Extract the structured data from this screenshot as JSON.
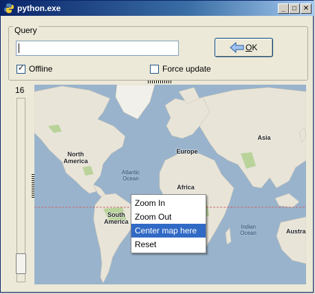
{
  "window": {
    "title": "python.exe",
    "buttons": {
      "minimize": "_",
      "maximize": "□",
      "close": "✕"
    }
  },
  "query": {
    "group_label": "Query",
    "input_value": "",
    "ok_label": "OK"
  },
  "options": {
    "offline_label": "Offline",
    "offline_checked": true,
    "force_update_label": "Force update",
    "force_update_checked": false
  },
  "zoom": {
    "level": "16",
    "slider_value": 16
  },
  "map": {
    "labels": {
      "north_america": "North\nAmerica",
      "south_america": "South\nAmerica",
      "europe": "Europe",
      "africa": "Africa",
      "asia": "Asia",
      "australia": "Austra",
      "atlantic": "Atlantic\nOcean",
      "indian": "Indian\nOcean"
    },
    "colors": {
      "ocean": "#99b3cc",
      "land": "#e8e4d8",
      "equator": "#cc6666"
    }
  },
  "context_menu": {
    "items": [
      "Zoom In",
      "Zoom Out",
      "Center map here",
      "Reset"
    ],
    "selected_index": 2
  }
}
